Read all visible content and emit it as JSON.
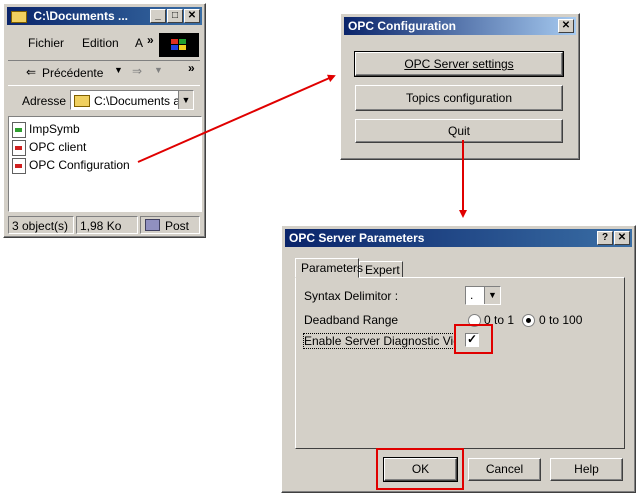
{
  "explorer": {
    "title": "C:\\Documents ...",
    "menu": [
      "Fichier",
      "Edition",
      "A",
      "»"
    ],
    "back_label": "Précédente",
    "address_label": "Adresse",
    "address_value": "C:\\Documents a",
    "files": [
      "ImpSymb",
      "OPC client",
      "OPC Configuration"
    ],
    "status": {
      "count": "3 object(s)",
      "size": "1,98 Ko",
      "location": "Post"
    }
  },
  "opc_config": {
    "title": "OPC Configuration",
    "buttons": [
      "OPC Server settings",
      "Topics configuration",
      "Quit"
    ]
  },
  "opc_params": {
    "title": "OPC Server Parameters",
    "tabs": [
      "Parameters",
      "Expert"
    ],
    "syntax_label": "Syntax Delimitor :",
    "syntax_value": ".",
    "deadband_label": "Deadband Range",
    "deadband_options": [
      "0 to 1",
      "0 to 100"
    ],
    "diag_label": "Enable Server Diagnostic View",
    "diag_checked": true,
    "ok_label": "OK",
    "cancel_label": "Cancel",
    "help_label": "Help"
  },
  "colors": {
    "annotation": "#e00000",
    "titlebar": "#0a246a"
  }
}
